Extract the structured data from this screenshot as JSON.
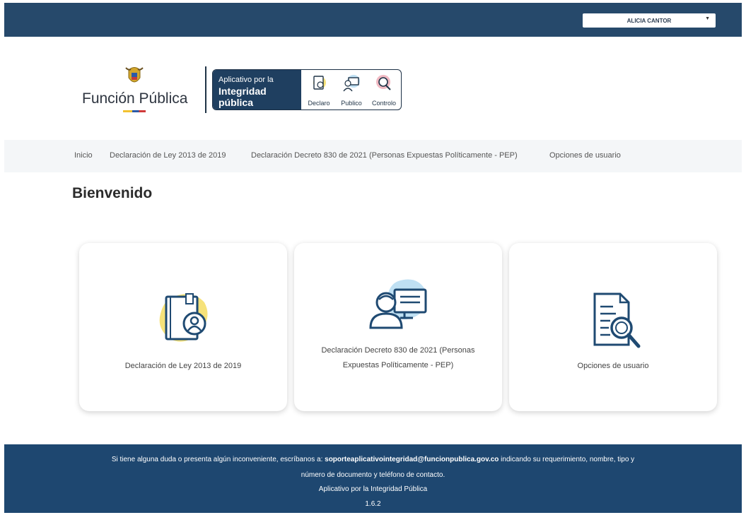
{
  "header": {
    "user_name": "ALICIA CANTOR"
  },
  "brand": {
    "name": "Función Pública"
  },
  "app_badge": {
    "line1": "Aplicativo por la",
    "line2": "Integridad pública",
    "items": [
      {
        "label": "Declaro",
        "icon": "declaro-icon"
      },
      {
        "label": "Publico",
        "icon": "publico-icon"
      },
      {
        "label": "Controlo",
        "icon": "controlo-icon"
      }
    ]
  },
  "nav": {
    "items": [
      "Inicio",
      "Declaración de Ley 2013 de 2019",
      "Declaración Decreto 830 de 2021 (Personas Expuestas Políticamente - PEP)",
      "Opciones de usuario"
    ]
  },
  "main": {
    "title": "Bienvenido",
    "cards": [
      {
        "label": "Declaración de Ley 2013 de 2019",
        "icon": "declaration-book-icon",
        "accent": "#f6e27a"
      },
      {
        "label": "Declaración Decreto 830 de 2021 (Personas Expuestas Políticamente - PEP)",
        "icon": "person-monitor-icon",
        "accent": "#bfe0f3"
      },
      {
        "label": "Opciones de usuario",
        "icon": "document-search-icon",
        "accent": "#1f4a72"
      }
    ]
  },
  "footer": {
    "line1_pre": "Si tiene alguna duda o presenta algún inconveniente, escríbanos a: ",
    "email": "soporteaplicativointegridad@funcionpublica.gov.co",
    "line1_post": " indicando su requerimiento, nombre, tipo y",
    "line2": "número de documento y teléfono de contacto.",
    "line3": "Aplicativo por la Integridad Pública",
    "version": "1.6.2"
  },
  "colors": {
    "topbar": "#26496b",
    "footer": "#1e4770",
    "nav_bg": "#f4f6f8"
  }
}
